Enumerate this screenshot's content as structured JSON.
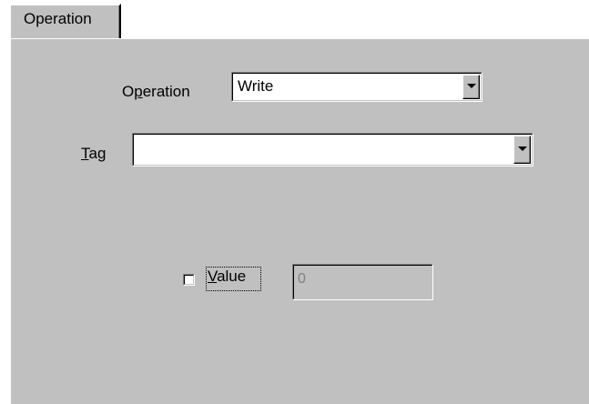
{
  "tab": {
    "label": "Operation"
  },
  "operation": {
    "label_pre": "O",
    "label_mnemonic": "p",
    "label_post": "eration",
    "value": "Write"
  },
  "tag": {
    "label_mnemonic": "T",
    "label_post": "ag",
    "value": ""
  },
  "value_option": {
    "label_mnemonic": "V",
    "label_post": "alue",
    "checked": false,
    "field_value": "0"
  }
}
